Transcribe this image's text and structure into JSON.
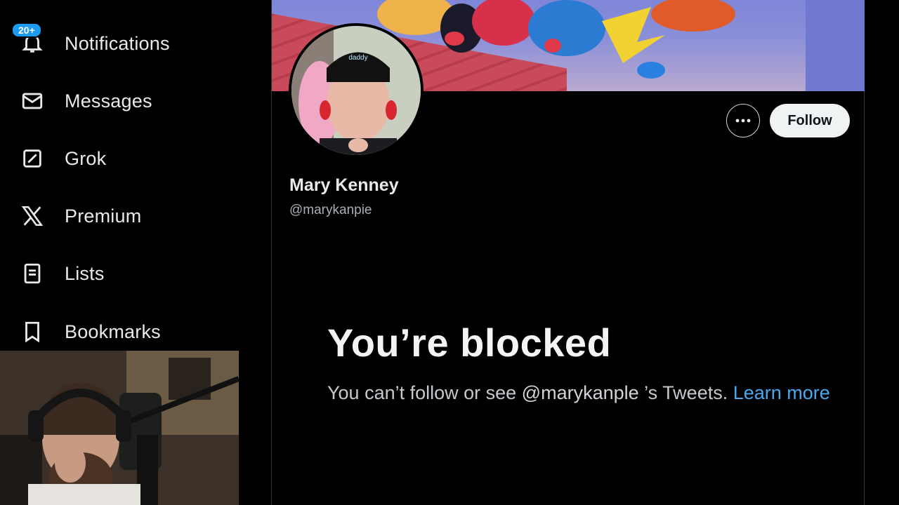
{
  "sidebar": {
    "items": [
      {
        "label": "Notifications",
        "icon": "bell-icon",
        "badge": "20+"
      },
      {
        "label": "Messages",
        "icon": "envelope-icon"
      },
      {
        "label": "Grok",
        "icon": "grok-icon"
      },
      {
        "label": "Premium",
        "icon": "x-logo-icon"
      },
      {
        "label": "Lists",
        "icon": "list-icon"
      },
      {
        "label": "Bookmarks",
        "icon": "bookmark-icon"
      }
    ]
  },
  "profile": {
    "display_name": "Mary Kenney",
    "handle": "@marykanpie",
    "follow_label": "Follow",
    "more_icon": "more-horizontal-icon",
    "avatar_hat_text": "daddy"
  },
  "blocked": {
    "title": "You’re blocked",
    "message_prefix": "You can’t follow or see ",
    "message_handle": "@marykanple",
    "message_suffix": " ’s Tweets. ",
    "link_text": "Learn more"
  },
  "colors": {
    "accent": "#1d9bf0",
    "link": "#49a8ee",
    "background": "#000000"
  }
}
